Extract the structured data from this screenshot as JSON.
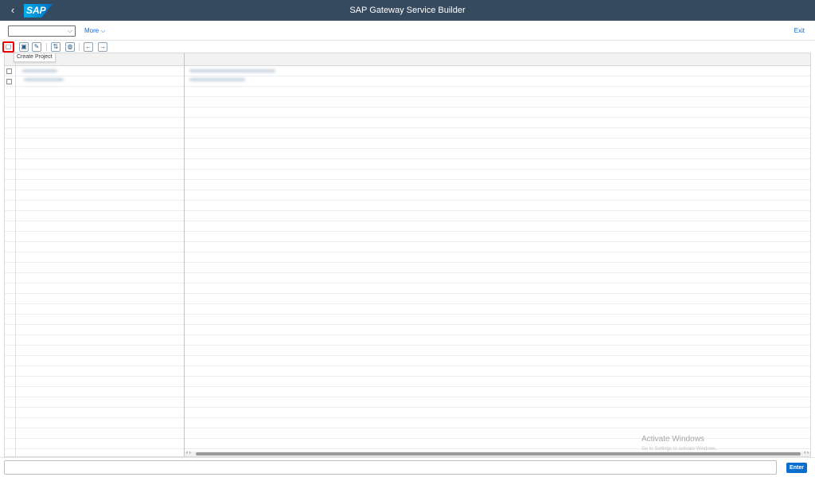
{
  "shell": {
    "title": "SAP Gateway Service Builder",
    "logo_text": "SAP",
    "back_glyph": "‹"
  },
  "toolbar": {
    "command_field_value": "",
    "more_label": "More",
    "exit_label": "Exit"
  },
  "app_toolbar": {
    "buttons": [
      {
        "name": "create-project-icon",
        "glyph": "▢"
      },
      {
        "name": "open-project-icon",
        "glyph": "▣"
      },
      {
        "name": "edit-project-icon",
        "glyph": "✎"
      },
      {
        "name": "import-icon",
        "glyph": "⇅"
      },
      {
        "name": "globe-icon",
        "glyph": "◍"
      },
      {
        "name": "arrow-left-icon",
        "glyph": "←"
      },
      {
        "name": "arrow-right-icon",
        "glyph": "→"
      }
    ],
    "tooltip": "Create Project"
  },
  "watermark": {
    "title": "Activate Windows",
    "subtitle": "Go to Settings to activate Windows."
  },
  "footer": {
    "enter_label": "Enter"
  },
  "colors": {
    "shell_bg": "#354a5f",
    "link": "#0a6ed1",
    "highlight": "#ee0000"
  }
}
